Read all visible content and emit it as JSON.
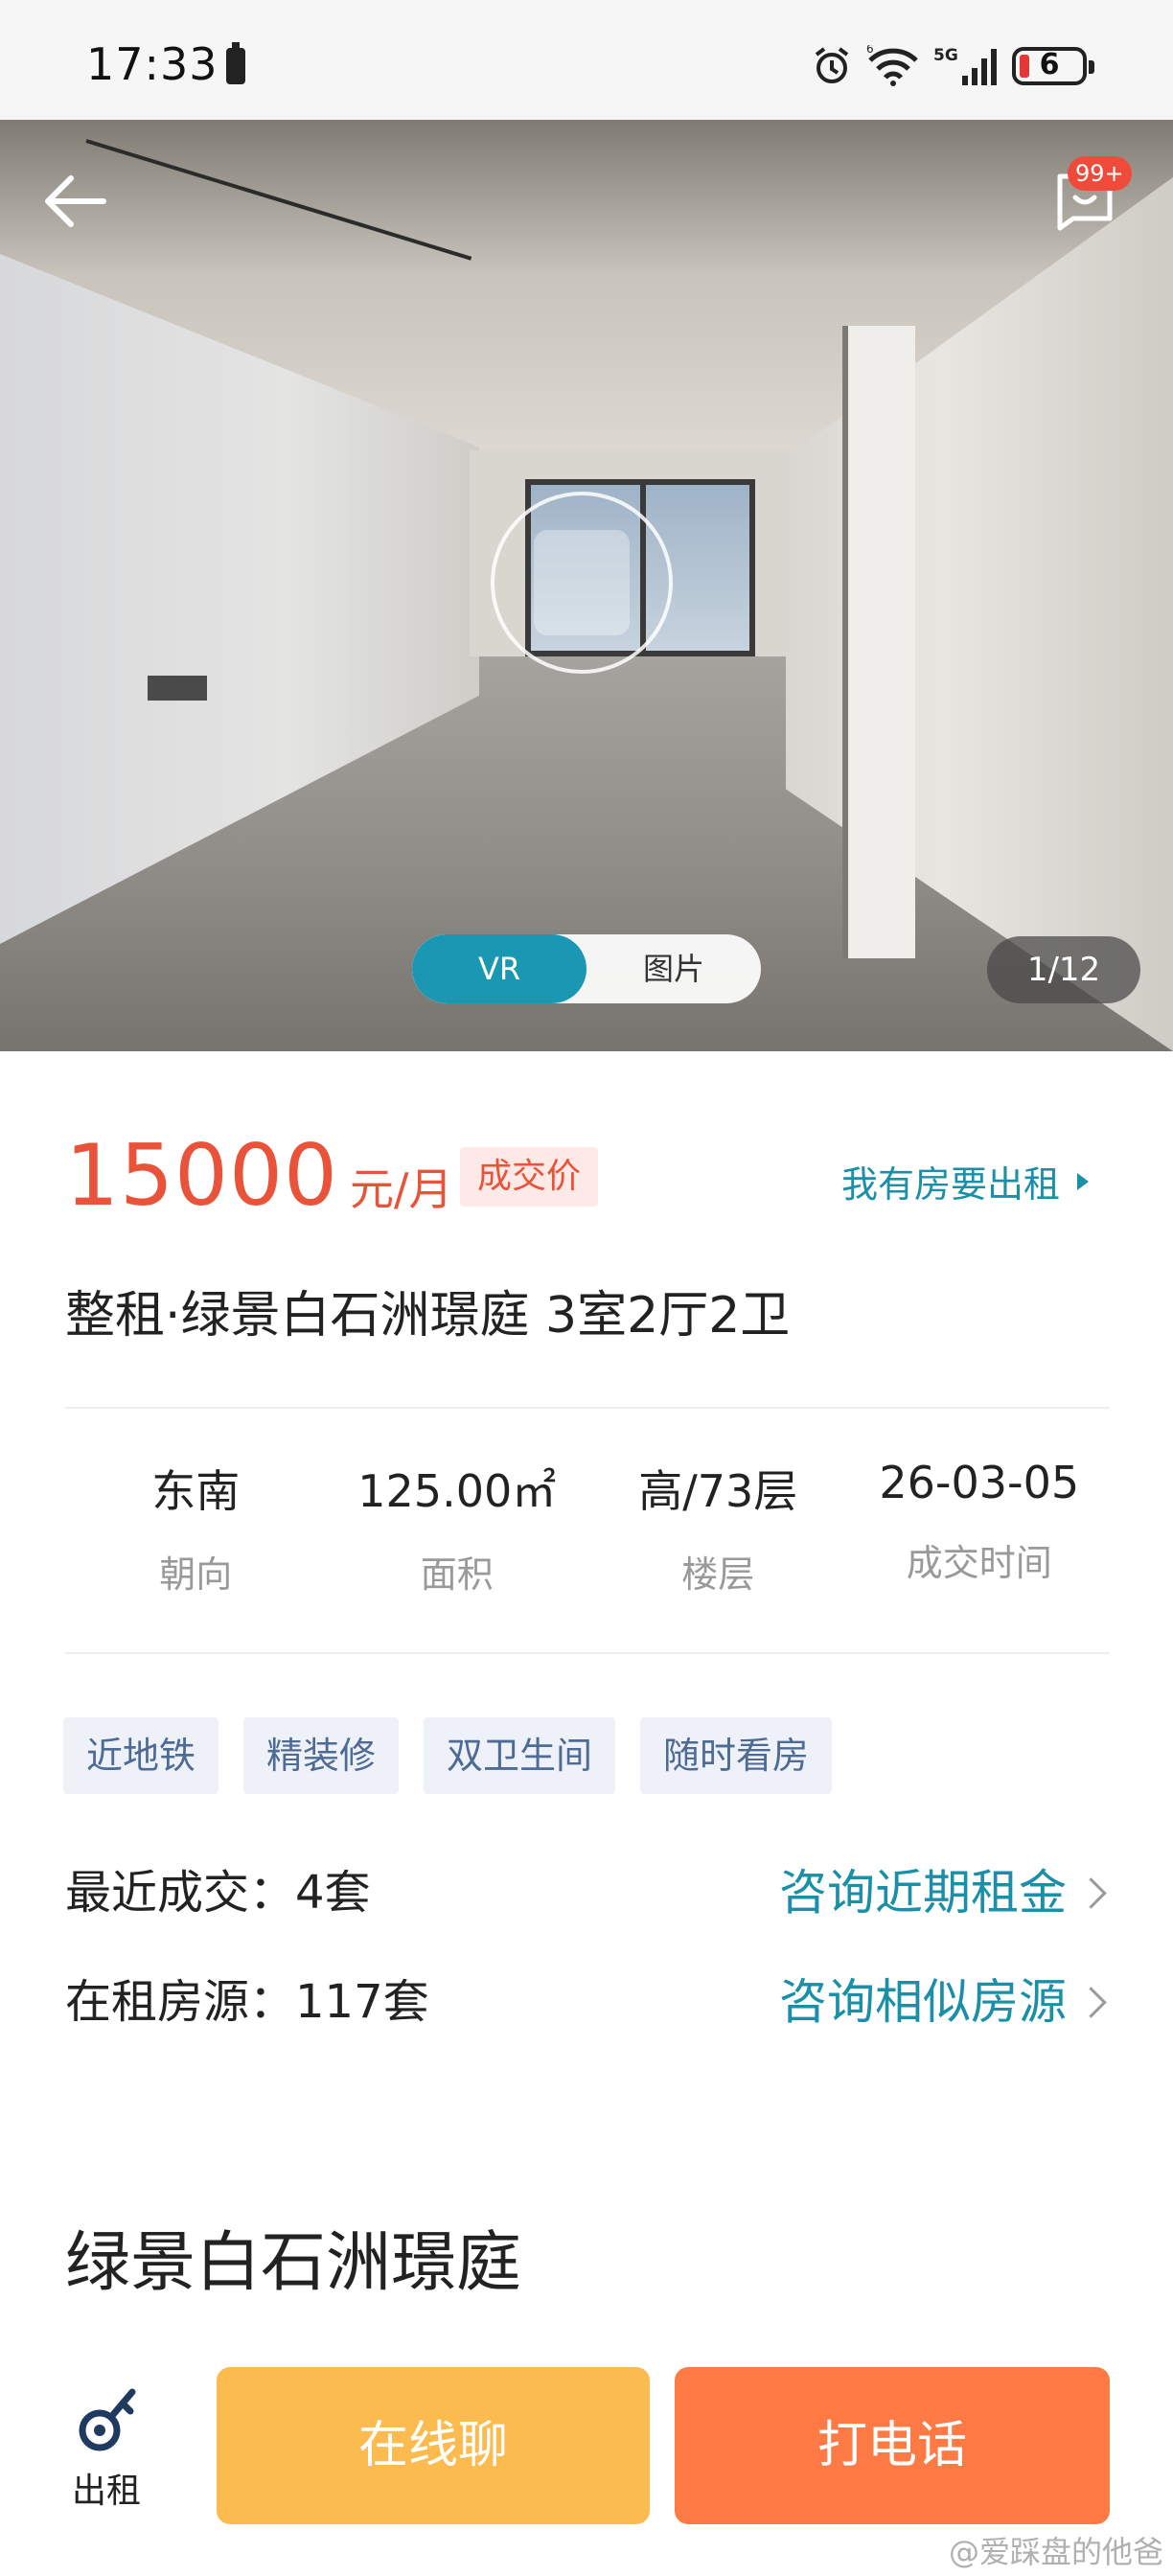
{
  "status_bar": {
    "time": "17:33",
    "network_label": "5G",
    "battery_level": "6",
    "icons": [
      "battery-saver-icon",
      "alarm-icon",
      "wifi-icon",
      "cellular-signal-icon",
      "battery-icon"
    ]
  },
  "gallery": {
    "badge_count": "99+",
    "toggle": {
      "vr_label": "VR",
      "photo_label": "图片",
      "selected": "VR"
    },
    "counter": "1/12",
    "icons": [
      "back-arrow-icon",
      "message-icon",
      "vr-360-icon"
    ]
  },
  "listing": {
    "price": "15000",
    "price_unit": "元/月",
    "price_tag": "成交价",
    "rent_out_link": "我有房要出租",
    "title": "整租·绿景白石洲璟庭 3室2厅2卫",
    "stats": [
      {
        "value": "东南",
        "label": "朝向"
      },
      {
        "value": "125.00㎡",
        "label": "面积"
      },
      {
        "value": "高/73层",
        "label": "楼层"
      },
      {
        "value": "26-03-05",
        "label": "成交时间"
      }
    ],
    "tags": [
      "近地铁",
      "精装修",
      "双卫生间",
      "随时看房"
    ],
    "recent_deals": {
      "label": "最近成交：4套",
      "link": "咨询近期租金"
    },
    "for_rent": {
      "label": "在租房源：117套",
      "link": "咨询相似房源"
    },
    "community_name": "绿景白石洲璟庭"
  },
  "bottom_bar": {
    "rent_label": "出租",
    "chat_button": "在线聊",
    "call_button": "打电话"
  },
  "watermark": "@爱踩盘的他爸",
  "colors": {
    "price": "#e9533a",
    "link": "#1a8fa8",
    "vr_active": "#1a98b3",
    "chat_button": "#fcbb4e",
    "call_button": "#fe7a45",
    "tag_bg": "#eef2f8"
  }
}
